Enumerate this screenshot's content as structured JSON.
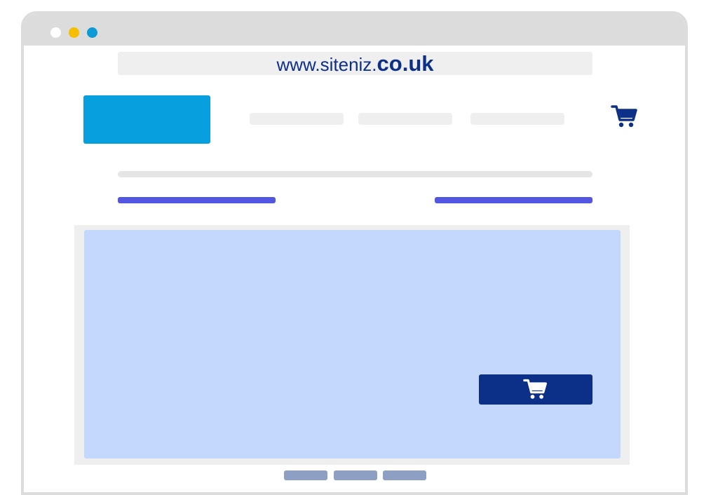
{
  "browser": {
    "url_prefix": "www.siteniz.",
    "url_tld": "co.uk",
    "traffic_light_colors": [
      "#ffffff",
      "#f7be00",
      "#0d9bd8"
    ]
  },
  "colors": {
    "logo": "#079fdd",
    "accent_link": "#5356e0",
    "brand_dark": "#0c2f88",
    "hero_bg": "#c4d8fe",
    "carousel_indicator": "#8d9fc3"
  },
  "header": {
    "cart_icon": "shopping-cart-icon",
    "nav_items_count": 3
  },
  "hero": {
    "button_icon": "shopping-cart-icon"
  },
  "carousel": {
    "indicator_count": 3
  }
}
